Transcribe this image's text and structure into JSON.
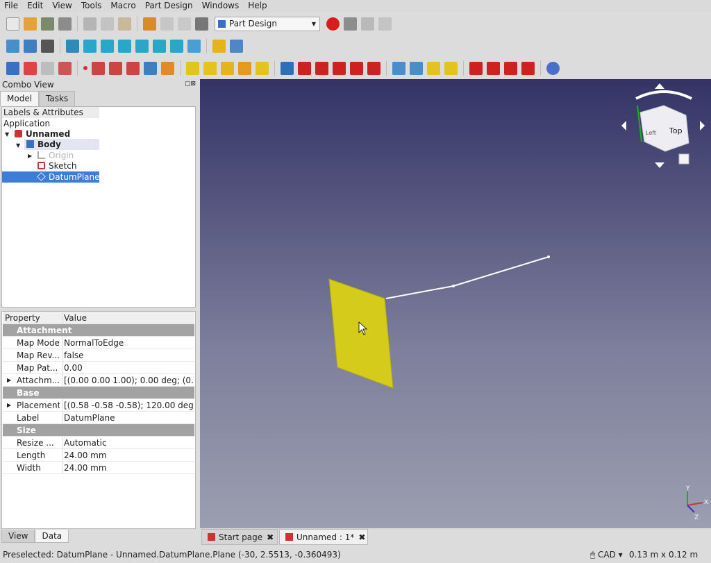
{
  "menu": [
    "File",
    "Edit",
    "View",
    "Tools",
    "Macro",
    "Part Design",
    "Windows",
    "Help"
  ],
  "workbench": "Part Design",
  "panel": {
    "title": "Combo View",
    "tabs": [
      "Model",
      "Tasks"
    ],
    "bottom_tabs": [
      "View",
      "Data"
    ]
  },
  "tree": {
    "header": "Labels & Attributes",
    "application": "Application",
    "items": [
      {
        "label": "Unnamed",
        "bold": true
      },
      {
        "label": "Body",
        "bold": true
      },
      {
        "label": "Origin",
        "dim": true
      },
      {
        "label": "Sketch"
      },
      {
        "label": "DatumPlane",
        "selected": true
      }
    ]
  },
  "props": {
    "col_property": "Property",
    "col_value": "Value",
    "rows": [
      {
        "group": "Attachment"
      },
      {
        "name": "Map Mode",
        "value": "NormalToEdge"
      },
      {
        "name": "Map Rev...",
        "value": "false"
      },
      {
        "name": "Map Pat...",
        "value": "0.00"
      },
      {
        "name": "Attachm...",
        "value": "[(0.00 0.00 1.00); 0.00 deg; (0.0...",
        "expand": true
      },
      {
        "group": "Base"
      },
      {
        "name": "Placement",
        "value": "[(0.58 -0.58 -0.58); 120.00 deg; (...",
        "expand": true
      },
      {
        "name": "Label",
        "value": "DatumPlane"
      },
      {
        "group": "Size"
      },
      {
        "name": "Resize ...",
        "value": "Automatic"
      },
      {
        "name": "Length",
        "value": "24.00 mm"
      },
      {
        "name": "Width",
        "value": "24.00 mm"
      }
    ]
  },
  "navcube": {
    "face_top": "Top",
    "face_left": "Left",
    "axis_x": "X",
    "axis_y": "Y",
    "axis_z": "Z"
  },
  "doc_tabs": [
    {
      "label": "Start page"
    },
    {
      "label": "Unnamed : 1*",
      "active": true
    }
  ],
  "status": {
    "text": "Preselected: DatumPlane - Unnamed.DatumPlane.Plane (-30, 2.5513, -0.360493)",
    "nav_style": "CAD",
    "dimensions": "0.13 m x 0.12 m"
  },
  "colors": {
    "datum_plane": "#d4cb1a",
    "selection": "#3b7dd8",
    "record": "#d61e1e"
  }
}
